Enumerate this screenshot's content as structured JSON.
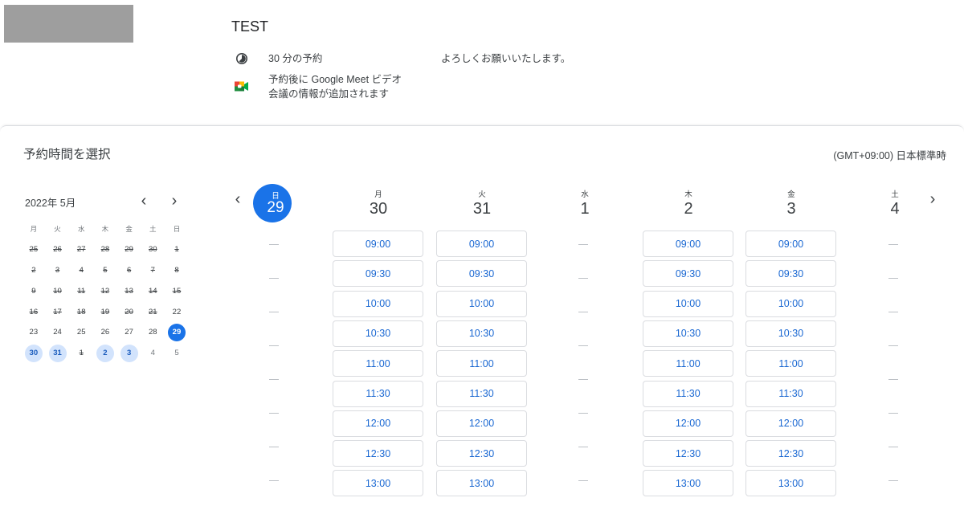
{
  "event": {
    "title": "TEST",
    "duration": "30 分の予約",
    "meet_line1": "予約後に Google Meet ビデオ",
    "meet_line2": "会議の情報が追加されます",
    "description": "よろしくお願いいたします。"
  },
  "section": {
    "title": "予約時間を選択",
    "timezone": "(GMT+09:00) 日本標準時"
  },
  "mini_calendar": {
    "month_label": "2022年 5月",
    "weekday_labels": [
      "月",
      "火",
      "水",
      "木",
      "金",
      "土",
      "日"
    ],
    "weeks": [
      [
        {
          "d": "25",
          "s": "past"
        },
        {
          "d": "26",
          "s": "past"
        },
        {
          "d": "27",
          "s": "past"
        },
        {
          "d": "28",
          "s": "past"
        },
        {
          "d": "29",
          "s": "past"
        },
        {
          "d": "30",
          "s": "past"
        },
        {
          "d": "1",
          "s": "past"
        }
      ],
      [
        {
          "d": "2",
          "s": "past"
        },
        {
          "d": "3",
          "s": "past"
        },
        {
          "d": "4",
          "s": "past"
        },
        {
          "d": "5",
          "s": "past"
        },
        {
          "d": "6",
          "s": "past"
        },
        {
          "d": "7",
          "s": "past"
        },
        {
          "d": "8",
          "s": "past"
        }
      ],
      [
        {
          "d": "9",
          "s": "past"
        },
        {
          "d": "10",
          "s": "past"
        },
        {
          "d": "11",
          "s": "past"
        },
        {
          "d": "12",
          "s": "past"
        },
        {
          "d": "13",
          "s": "past"
        },
        {
          "d": "14",
          "s": "past"
        },
        {
          "d": "15",
          "s": "past"
        }
      ],
      [
        {
          "d": "16",
          "s": "past"
        },
        {
          "d": "17",
          "s": "past"
        },
        {
          "d": "18",
          "s": "past"
        },
        {
          "d": "19",
          "s": "past"
        },
        {
          "d": "20",
          "s": "past"
        },
        {
          "d": "21",
          "s": "past"
        },
        {
          "d": "22",
          "s": "normal"
        }
      ],
      [
        {
          "d": "23",
          "s": "normal"
        },
        {
          "d": "24",
          "s": "normal"
        },
        {
          "d": "25",
          "s": "normal"
        },
        {
          "d": "26",
          "s": "normal"
        },
        {
          "d": "27",
          "s": "normal"
        },
        {
          "d": "28",
          "s": "normal"
        },
        {
          "d": "29",
          "s": "today"
        }
      ],
      [
        {
          "d": "30",
          "s": "avail"
        },
        {
          "d": "31",
          "s": "avail"
        },
        {
          "d": "1",
          "s": "past"
        },
        {
          "d": "2",
          "s": "avail"
        },
        {
          "d": "3",
          "s": "avail"
        },
        {
          "d": "4",
          "s": "muted"
        },
        {
          "d": "5",
          "s": "muted"
        }
      ]
    ]
  },
  "week": {
    "days": [
      {
        "dow": "日",
        "num": "29",
        "today": true,
        "slots": []
      },
      {
        "dow": "月",
        "num": "30",
        "today": false,
        "slots": [
          "09:00",
          "09:30",
          "10:00",
          "10:30",
          "11:00",
          "11:30",
          "12:00",
          "12:30",
          "13:00"
        ]
      },
      {
        "dow": "火",
        "num": "31",
        "today": false,
        "slots": [
          "09:00",
          "09:30",
          "10:00",
          "10:30",
          "11:00",
          "11:30",
          "12:00",
          "12:30",
          "13:00"
        ]
      },
      {
        "dow": "水",
        "num": "1",
        "today": false,
        "slots": []
      },
      {
        "dow": "木",
        "num": "2",
        "today": false,
        "slots": [
          "09:00",
          "09:30",
          "10:00",
          "10:30",
          "11:00",
          "11:30",
          "12:00",
          "12:30",
          "13:00"
        ]
      },
      {
        "dow": "金",
        "num": "3",
        "today": false,
        "slots": [
          "09:00",
          "09:30",
          "10:00",
          "10:30",
          "11:00",
          "11:30",
          "12:00",
          "12:30",
          "13:00"
        ]
      },
      {
        "dow": "土",
        "num": "4",
        "today": false,
        "slots": []
      }
    ]
  },
  "colors": {
    "accent": "#1a73e8",
    "slot_text": "#1967d2",
    "avail_bg": "#d2e3fc"
  }
}
